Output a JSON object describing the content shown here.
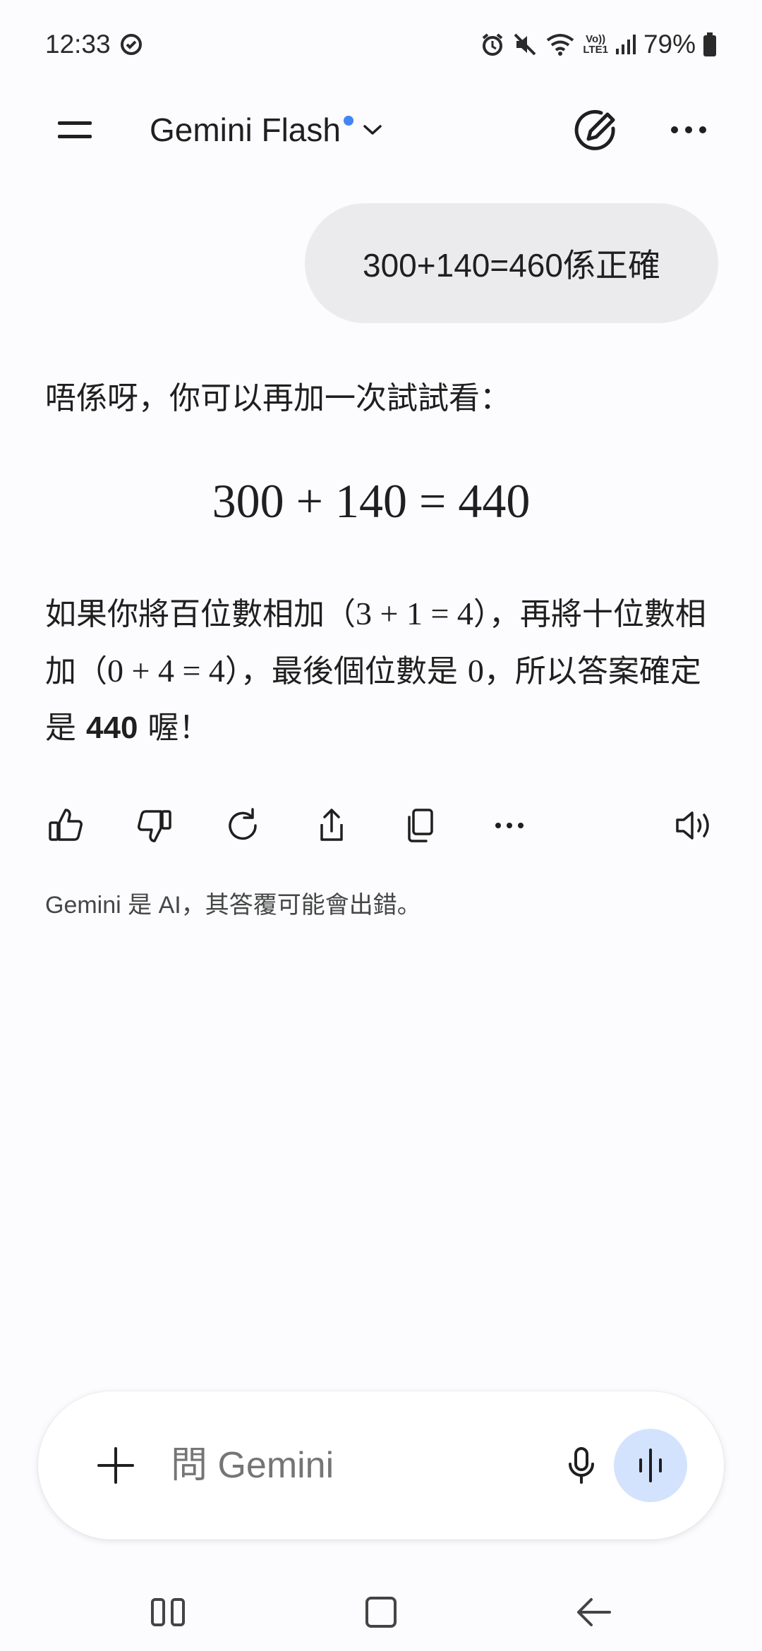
{
  "status_bar": {
    "time": "12:33",
    "volte_top": "Vo))",
    "volte_bottom": "LTE1",
    "battery": "79%",
    "icons": [
      "sync-icon",
      "alarm-icon",
      "mute-icon",
      "wifi-icon",
      "signal-icon",
      "battery-icon"
    ]
  },
  "header": {
    "model_name": "Gemini Flash",
    "icons": [
      "menu-icon",
      "chevron-down-icon",
      "new-chat-icon",
      "more-icon"
    ],
    "accent_color": "#4285f4"
  },
  "conversation": {
    "user_message": "300+140=460係正確",
    "response": {
      "intro": "唔係呀，你可以再加一次試試看：",
      "math_display": "300 + 140 = 440",
      "body_1": "如果你將百位數相加（",
      "math_1": "3 + 1 = 4",
      "body_2": "），再將十位數相加（",
      "math_2": "0 + 4 = 4",
      "body_3": "），最後個位數是 ",
      "math_3": "0",
      "body_4": "，所以答案確定是 ",
      "answer": "440",
      "body_5": " 喔！"
    }
  },
  "actions": {
    "icons": [
      "thumbs-up-icon",
      "thumbs-down-icon",
      "regenerate-icon",
      "share-icon",
      "copy-icon",
      "more-horizontal-icon",
      "read-aloud-icon"
    ]
  },
  "disclaimer": "Gemini 是 AI，其答覆可能會出錯。",
  "input": {
    "placeholder": "問 Gemini",
    "value": "",
    "icons": [
      "plus-icon",
      "mic-icon",
      "live-icon"
    ],
    "live_bg": "#d3e3fd"
  },
  "nav_bar": {
    "icons": [
      "recents-icon",
      "home-icon",
      "back-icon"
    ]
  }
}
